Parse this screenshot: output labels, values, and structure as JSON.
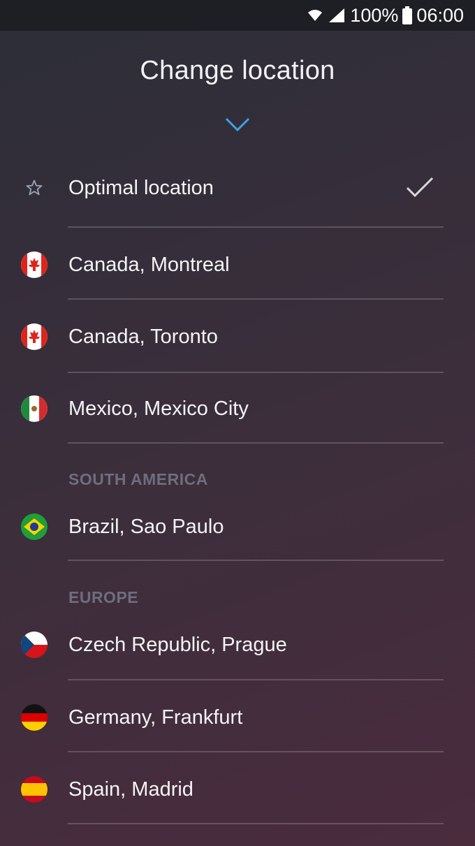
{
  "status_bar": {
    "battery": "100%",
    "time": "06:00",
    "icons": [
      "wifi-icon",
      "signal-icon",
      "battery-icon"
    ]
  },
  "header": {
    "title": "Change location",
    "collapse_icon": "chevron-down-icon",
    "accent_color": "#3ea3e8"
  },
  "optimal": {
    "label": "Optimal location",
    "icon": "star-outline-icon",
    "selected": true,
    "selected_icon": "checkmark-icon"
  },
  "locations": [
    {
      "label": "Canada, Montreal",
      "flag": "canada-flag-icon"
    },
    {
      "label": "Canada, Toronto",
      "flag": "canada-flag-icon"
    },
    {
      "label": "Mexico, Mexico City",
      "flag": "mexico-flag-icon"
    }
  ],
  "sections": [
    {
      "title": "SOUTH AMERICA",
      "items": [
        {
          "label": "Brazil, Sao Paulo",
          "flag": "brazil-flag-icon"
        }
      ]
    },
    {
      "title": "EUROPE",
      "items": [
        {
          "label": "Czech Republic, Prague",
          "flag": "czech-flag-icon"
        },
        {
          "label": "Germany, Frankfurt",
          "flag": "germany-flag-icon"
        },
        {
          "label": "Spain, Madrid",
          "flag": "spain-flag-icon"
        }
      ]
    }
  ]
}
